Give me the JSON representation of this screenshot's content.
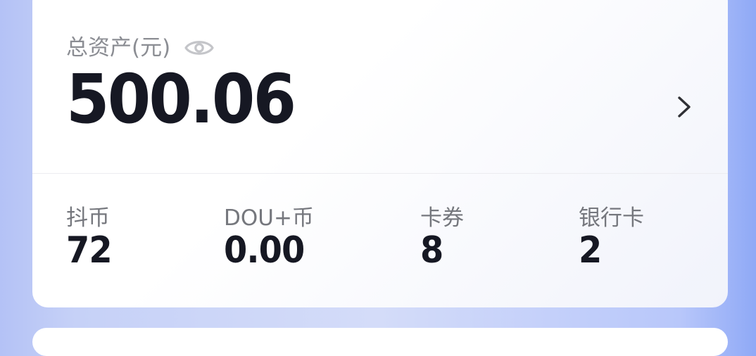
{
  "assets": {
    "total_label": "总资产(元)",
    "total_amount": "500.06"
  },
  "icons": {
    "visibility": "eye-icon",
    "details": "chevron-right-icon"
  },
  "stats": [
    {
      "label": "抖币",
      "value": "72"
    },
    {
      "label": "DOU+币",
      "value": "0.00"
    },
    {
      "label": "卡券",
      "value": "8"
    },
    {
      "label": "银行卡",
      "value": "2"
    }
  ],
  "colors": {
    "primary_text": "#161823",
    "secondary_text": "#8b8d93",
    "card_background": "#ffffff",
    "page_gradient_left": "#b4c2f6",
    "page_gradient_right": "#8fa9f6"
  }
}
